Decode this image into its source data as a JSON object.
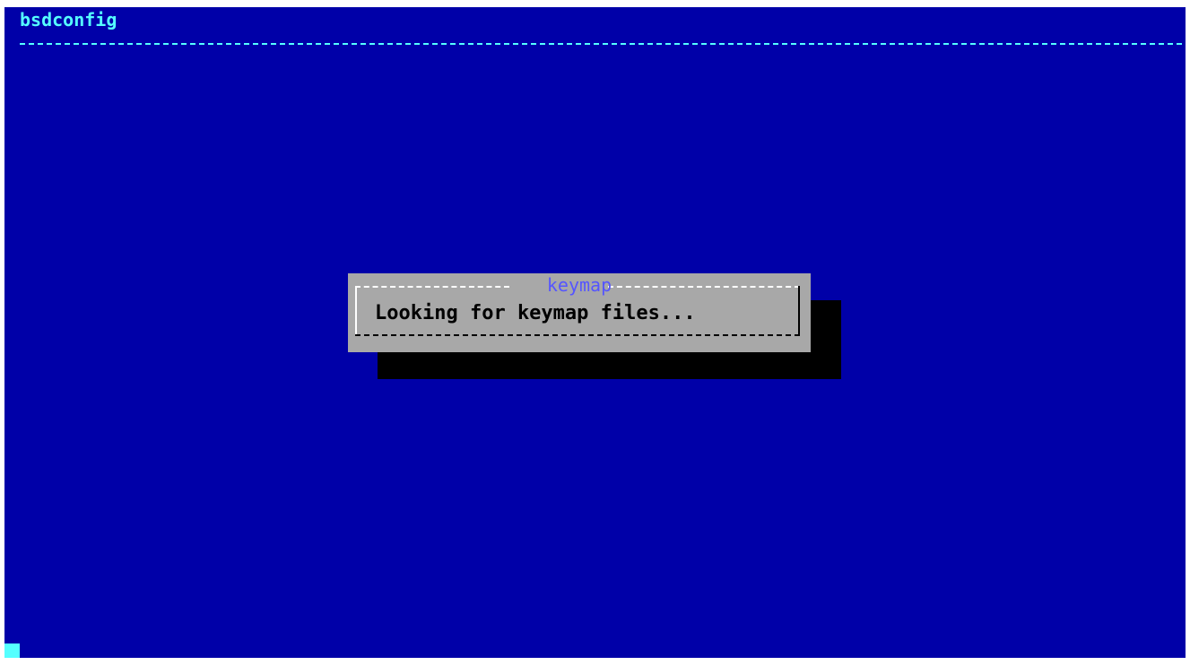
{
  "backtitle": "bsdconfig",
  "dialog": {
    "title": "keymap",
    "message": "Looking for keymap files..."
  },
  "colors": {
    "screen_background": "#0000a8",
    "backtitle_text": "#55ffff",
    "dialog_background": "#a8a8a8",
    "dialog_title_text": "#5555ff",
    "dialog_message_text": "#000000",
    "shadow": "#000000",
    "cursor": "#55ffff"
  }
}
